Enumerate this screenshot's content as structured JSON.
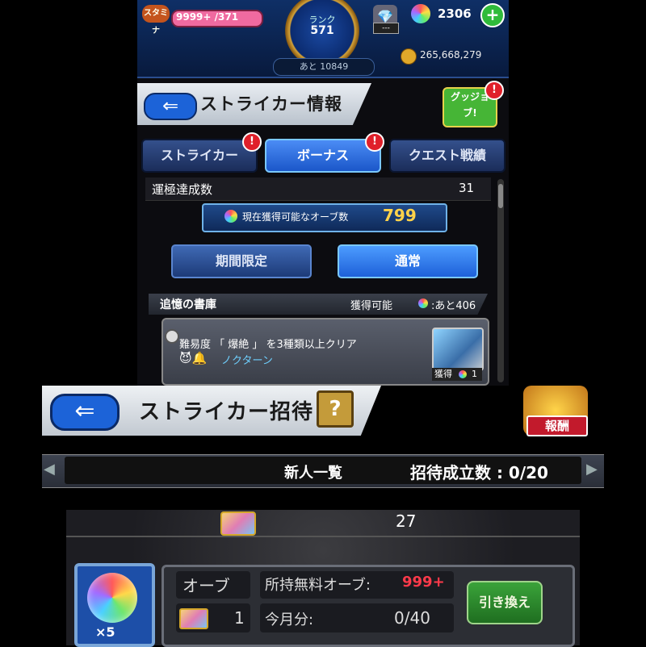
{
  "hud": {
    "stamina_label": "スタミナ",
    "stamina_text": "9999+ /371",
    "rank_label": "ランク",
    "rank_value": "571",
    "exp_remaining": "あと 10849",
    "chest_status": "---",
    "orb_count": "2306",
    "plus_icon": "+",
    "coin_count": "265,668,279"
  },
  "header": {
    "back_icon": "⇐",
    "title": "ストライカー情報",
    "good_job_label": "グッジョブ!",
    "alert": "!"
  },
  "tabs": [
    {
      "label": "ストライカー",
      "active": false
    },
    {
      "label": "ボーナス",
      "active": true
    },
    {
      "label": "クエスト戦績",
      "active": false
    }
  ],
  "luck": {
    "label": "運極達成数",
    "value": "31"
  },
  "available_orbs": {
    "label": "現在獲得可能なオーブ数",
    "value": "799"
  },
  "modes": [
    {
      "label": "期間限定",
      "active": false
    },
    {
      "label": "通常",
      "active": true
    }
  ],
  "section": {
    "title": "追憶の書庫",
    "obtainable": "獲得可能",
    "remaining": ":あと406"
  },
  "quest": {
    "description": "難易度 「 爆絶 」 を3種類以上クリア",
    "icons": "😈🔔",
    "target": "ノクターン",
    "reward_label": "獲得",
    "reward_value": "1"
  },
  "invite": {
    "back_icon": "⇐",
    "title": "ストライカー招待",
    "help": "?",
    "reward_badge": "報酬",
    "list_title": "新人一覧",
    "count": "招待成立数 : 0/20"
  },
  "exchange": {
    "ticket_count_top": "27",
    "orb_multiplier": "×5",
    "orb_label": "オーブ",
    "ticket_value": "1",
    "free_orb_label": "所持無料オーブ:",
    "free_orb_value": "999+",
    "month_label": "今月分:",
    "month_value": "0/40",
    "exchange_button": "引き換え"
  },
  "colors": {
    "accent_blue": "#1c63d8",
    "orb_highlight": "#ffd24a",
    "alert_red": "#e0202a",
    "exchange_green": "#3aa33a"
  }
}
